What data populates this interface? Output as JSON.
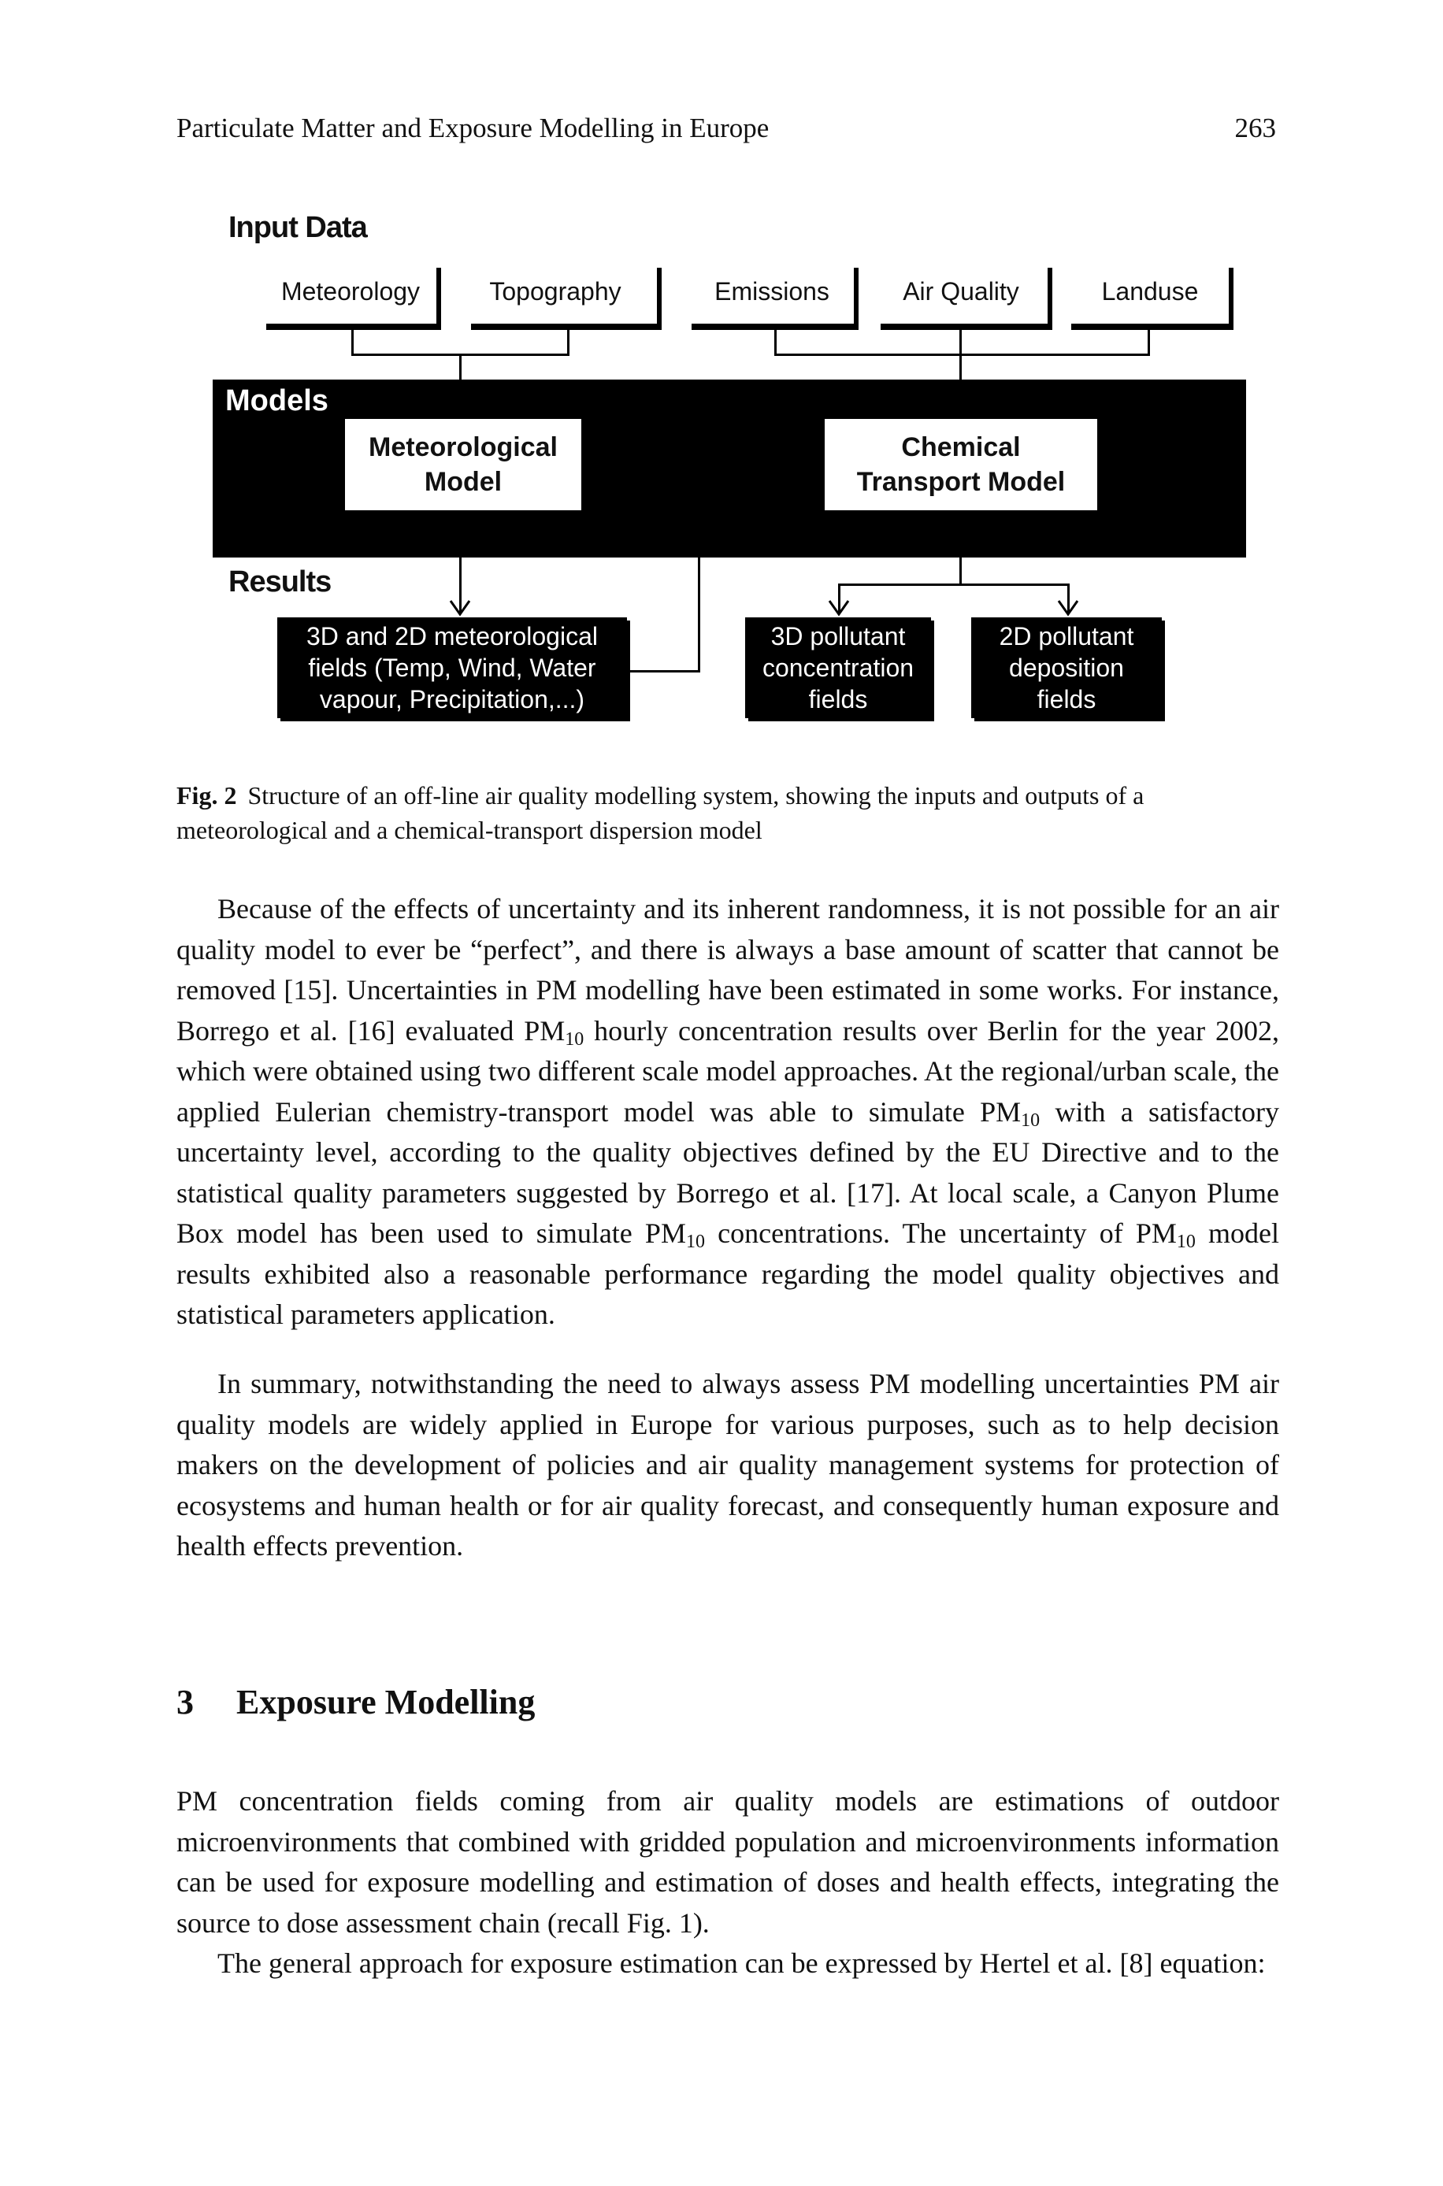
{
  "header": {
    "running_title": "Particulate Matter and Exposure Modelling in Europe",
    "page_number": "263"
  },
  "figure": {
    "input_section_label": "Input Data",
    "inputs": [
      {
        "label": "Meteorology"
      },
      {
        "label": "Topography"
      },
      {
        "label": "Emissions"
      },
      {
        "label": "Air Quality"
      },
      {
        "label": "Landuse"
      }
    ],
    "models_section_label": "Models",
    "models": [
      {
        "line1": "Meteorological",
        "line2": "Model"
      },
      {
        "line1": "Chemical",
        "line2": "Transport Model"
      }
    ],
    "results_section_label": "Results",
    "results": [
      {
        "lines": [
          "3D and 2D meteorological",
          "fields (Temp, Wind, Water",
          "vapour, Precipitation,...)"
        ]
      },
      {
        "lines": [
          "3D pollutant",
          "concentration",
          "fields"
        ]
      },
      {
        "lines": [
          "2D pollutant",
          "deposition",
          "fields"
        ]
      }
    ],
    "caption_label": "Fig. 2",
    "caption_text": "Structure of an off-line air quality modelling system, showing the inputs and outputs of a meteorological and a chemical-transport dispersion model"
  },
  "body": {
    "p1_parts": [
      "Because of the effects of uncertainty and its inherent randomness, it is not possible for an air quality model to ever be “perfect”, and there is always a base amount of scatter that cannot be removed [15]. Uncertainties in PM modelling have been estimated in some works. For instance, Borrego et al. [16] evaluated PM",
      "10",
      " hourly concentration results over Berlin for the year 2002, which were obtained using two different scale model approaches. At the regional/urban scale, the applied Eulerian chemistry-transport model was able to simulate PM",
      "10",
      " with a satisfactory uncertainty level, according to the quality objectives defined by the EU Directive and to the statistical quality parameters suggested by Borrego et al. [17]. At local scale, a Canyon Plume Box model has been used to simulate PM",
      "10",
      " concentrations. The uncertainty of PM",
      "10",
      " model results exhibited also a reasonable performance regarding the model quality objectives and statistical parameters application."
    ],
    "p2": "In summary, notwithstanding the need to always assess PM modelling uncertainties PM air quality models are widely applied in Europe for various purposes, such as to help decision makers on the development of policies and air quality management systems for protection of ecosystems and human health or for air quality forecast, and consequently human exposure and health effects prevention.",
    "section": {
      "number": "3",
      "title": "Exposure Modelling"
    },
    "p3": "PM concentration fields coming from air quality models are estimations of outdoor microenvironments that combined with gridded population and microenvironments information can be used for exposure modelling and estimation of doses and health effects, integrating the source to dose assessment chain (recall Fig. 1).",
    "p4": "The general approach for exposure estimation can be expressed by Hertel et al. [8] equation:"
  }
}
